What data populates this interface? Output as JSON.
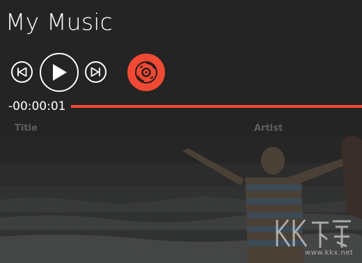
{
  "app": {
    "title": "My Music"
  },
  "player": {
    "elapsed": "-00:00:01",
    "progress_fraction": 1.0,
    "buttons": {
      "previous_icon": "skip-previous-icon",
      "play_icon": "play-icon",
      "next_icon": "skip-next-icon",
      "disc_icon": "music-disc-icon"
    }
  },
  "song_list": {
    "columns": [
      "Title",
      "Artist"
    ]
  },
  "watermark": {
    "text": "www.kkx.net"
  },
  "colors": {
    "background": "#242424",
    "accent": "#f14a34",
    "header_text": "#5d5d5d",
    "foreground": "#ffffff"
  }
}
